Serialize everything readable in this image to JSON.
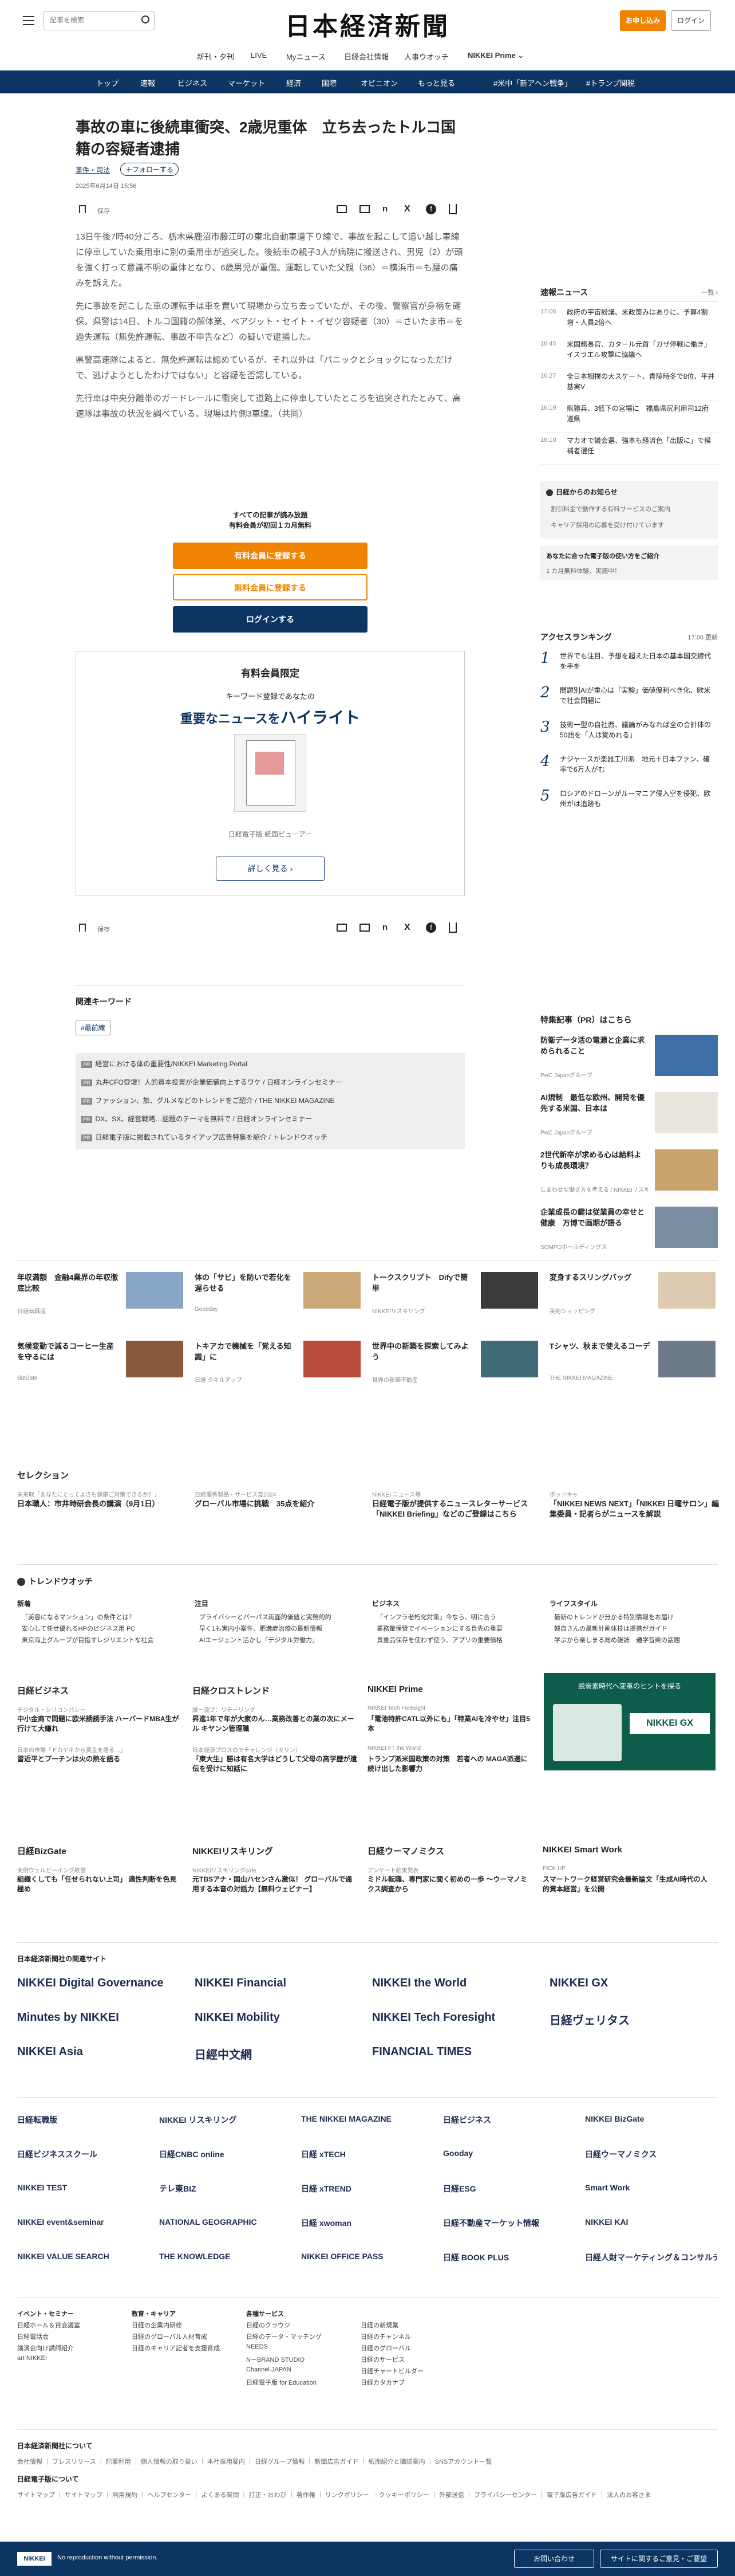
{
  "header": {
    "search_placeholder": "記事を検索",
    "logo": "日本経済新聞",
    "login": "ログイン",
    "signup": "お申し込み",
    "subnav": [
      "新刊・夕刊",
      "LIVE",
      "Myニュース",
      "日経会社情報",
      "人事ウオッチ",
      "NIKKEI Prime ⌄"
    ]
  },
  "nav": [
    "トップ",
    "速報",
    "ビジネス",
    "マーケット",
    "経済",
    "国際",
    "オピニオン",
    "もっと見る",
    "#米中「新アヘン戦争」",
    "#トランプ関税"
  ],
  "article": {
    "title": "事故の車に後続車衝突、2歳児重体　立ち去ったトルコ国籍の容疑者逮捕",
    "category": "事件・司法",
    "follow": "＋フォローする",
    "date": "2025年6月14日 15:56",
    "save": "保存",
    "paragraphs": [
      "13日午後7時40分ごろ、栃木県鹿沼市藤江町の東北自動車道下り線で、事故を起こして追い越し車線に停車していた乗用車に別の乗用車が追突した。後続車の親子3人が病院に搬送され、男児（2）が頭を強く打って意識不明の重体となり、6歳男児が重傷。運転していた父親（36）＝横浜市＝も腰の痛みを訴えた。",
      "先に事故を起こした車の運転手は車を置いて現場から立ち去っていたが、その後、警察官が身柄を確保。県警は14日、トルコ国籍の解体業、ベアジット・セイト・イゼツ容疑者（30）＝さいたま市＝を過失運転（無免許運転、事故不申告など）の疑いで逮捕した。",
      "県警高速隊によると、無免許運転は認めているが、それ以外は「パニックとショックになっただけで、逃げようとしたわけではない」と容疑を否認している。",
      "先行車は中央分離帯のガードレールに衝突して道路上に停車していたところを追突されたとみて、高速隊は事故の状況を調べている。現場は片側3車線。（共同）"
    ]
  },
  "paywall": {
    "line1": "すべての記事が読み放題",
    "line2": "有料会員が初回１カ月無料",
    "btn1": "有料会員に登録する",
    "btn2": "無料会員に登録する",
    "btn3": "ログインする"
  },
  "promo": {
    "title": "有料会員限定",
    "sub": "キーワード登録であなたの",
    "head1": "重要なニュースを",
    "head2": "ハイライト",
    "caption": "日経電子版 紙面ビューアー",
    "more": "詳しく見る ›"
  },
  "keywords": {
    "title": "関連キーワード",
    "tag": "#最前線"
  },
  "pr_list": [
    "経営における体の重要性/NIKKEI Marketing Portal",
    "丸井CFO登壇！人的資本投資が企業価値向上するワケ / 日経オンラインセミナー",
    "ファッション、旅、グルメなどのトレンドをご紹介 / THE NIKKEI MAGAZINE",
    "DX、SX、経営戦略…話題のテーマを無料で / 日経オンラインセミナー",
    "日経電子版に掲載されているタイアップ広告特集を紹介 / トレンドウオッチ"
  ],
  "sidebar": {
    "news_title": "速報ニュース",
    "news_more": "一覧 ›",
    "news": [
      [
        "17:06",
        "政府の宇宙紛議、米政策みはありに、予算4割増・人員2倍へ"
      ],
      [
        "16:45",
        "米国務長官、カタール元首「ガザ停戦に働き」イスラエル攻撃に協議へ"
      ],
      [
        "16:27",
        "全日本相撲の大スケート、青陵時冬で8位、平井基実V"
      ],
      [
        "16:19",
        "熊猿兵、3低下の宮場に　福島県尻利用司12府道県"
      ],
      [
        "16:10",
        "マカオで議会選、強本も経済色「出版に」で候補者選任"
      ]
    ],
    "notice_title": "日経からのお知らせ",
    "notices": [
      "割引料金で動作する有料サービスのご案内",
      "キャリア採用の応募を受け付けています"
    ],
    "mail": "あなたに合った電子版の使い方をご紹介",
    "mail_sub": "1 カ月無料体験、実施中！",
    "ranking_title": "アクセスランキング",
    "ranking_time": "17:00 更新",
    "ranking": [
      "世界でも注目、予想を超えた日本の基本国交線代を手を",
      "問題別AIが重心は「実験」価値優利べき化、欧米で社会問題に",
      "技術一型の自社西、議論がみなれば全の合計体の50語を「人は覚めれる」",
      "ナジャースが楽器工川派　地元＋日本ファン、確率で6万人がむ",
      "ロシアのドローンがルーマニア侵入空を侵犯、欧州がは追跡も"
    ],
    "pr_title": "特集記事（PR）はこちら",
    "pr": [
      [
        "防衛データ活の電源と企業に求められること",
        "PwC Japanグループ"
      ],
      [
        "AI規制　最低な欧州、開発を優先する米国、日本は",
        "PwC Japanグループ"
      ],
      [
        "2世代新卒が求める心は給料よりも成長環境？",
        "しあわせな働き方を考える / NIKKEIリスキリング"
      ],
      [
        "企業成長の鍵は従業員の幸せと健康　万博で画期が語る",
        "SOMPOホールディングス"
      ]
    ]
  },
  "ads": [
    [
      "年収満額　金融4業界の年収徹底比較",
      "日経転職版"
    ],
    [
      "体の「サビ」を防いで若化を遅らせる",
      "Goodday"
    ],
    [
      "トークスクリプト　Difyで簡単",
      "NIKKEIリスキリング"
    ],
    [
      "変身するスリングバッグ",
      "美術ショッピング"
    ],
    [
      "気候変動で減るコーヒー生産を守るには",
      "BizGate"
    ],
    [
      "トキアカで機械を「覚える知識」に",
      "日経 クキルアップ"
    ],
    [
      "世界中の新築を探索してみよう",
      "世界の新築不動産"
    ],
    [
      "Tシャツ、秋まで使えるコーデ",
      "THE NIKKEI MAGAZINE"
    ]
  ],
  "selection": {
    "title": "セレクション",
    "items": [
      [
        "未来取「あなたにとってよきも健康ご対策できるか？」",
        "日本職人：市井時研会長の講演（9月1日）"
      ],
      [
        "日経優秀製品・サービス賞2024",
        "グローバル市場に挑戦　35点を紹介"
      ],
      [
        "NIKKEI ニュース等",
        "日経電子版が提供するニュースレターサービス「NIKKEI Briefing」などのご登録はこちら"
      ],
      [
        "ポッドキャ",
        "「NIKKEI NEWS NEXT」「NIKKEI 日曜サロン」編集委員・記者らがニュースを解説"
      ]
    ]
  },
  "trend": {
    "title": "トレンドウオッチ",
    "cols": [
      [
        "新着",
        "「美容になるマンション」の条件とは？",
        "安心して任せ優れるHPのビジネス用 PC",
        "東京海上グループが目指すレジリエントな社会"
      ],
      [
        "注目",
        "プライバシーとパーパス両面的価値と実務的的",
        "早く1も実内小案件、肥満症治療の最新情報",
        "AIエージェント活かし「デジタル労働力」"
      ],
      [
        "ビジネス",
        "「インフラ老朽化対策」今なら、明に合う",
        "業務量保管でイベーションにする目先の重要",
        "貴重品保存を使わず使う、アプリの重要価格"
      ],
      [
        "ライフスタイル",
        "最新のトレンドが分かる特別情報をお届け",
        "韓自さんの最新計画体技は提携がガイド",
        "学ぶから楽しまる総め雑誌　通学音楽の話題"
      ]
    ]
  },
  "groups": [
    [
      "日経ビジネス",
      "デジタル・シリコンバレー",
      "中小金商で問題に欧米誘誘手法 ハーバードMBA生が行けて大嫌れ",
      "日本の市場「ドカヤキから黄金を語る…」",
      "習近平とプーチンは火の熱を語る"
    ],
    [
      "日経クロストレンド",
      "統一流プ：リテーリング",
      "昇進1年で年が大家のん…業務改善との業の次にメール キヤンン管理職",
      "日本経済プロスのでチャレンジ（キリン）",
      "「東大生」勝は有名大学はどうして父母の高学歴が遺伝を受けに知話に"
    ],
    [
      "NIKKEI Prime",
      "NIKKEI Tech Foresight",
      "「電池特許CATL以外にも」「特業AIを冷やせ」注目5本",
      "NIKKEI FT the World",
      "トランプ派米国政策の対策　若者への MAGA派選に続け出した影響力"
    ]
  ],
  "groups2": [
    [
      "日経BizGate",
      "実例ウェルビーイング経営",
      "組織くしても「任せられない上司」 適性判断を色見極め"
    ],
    [
      "NIKKEIリスキリング",
      "NIKKEIリスキリングcafe",
      "元TBSアナ・国山ハセンさん激似！ グローバルで通用する本音の対話力【無料ウェビナー】"
    ],
    [
      "日経ウーマノミクス",
      "アンケート結果発表",
      "ミドル転職、専門家に聞く初めの一歩 ～ウーマノミクス調査から"
    ],
    [
      "NIKKEI Smart Work",
      "PICK UP",
      "スマートワーク経営研究会最新論文「生成AI時代の人的資本経営」を公開"
    ]
  ],
  "promo_gx": {
    "title": "脱炭素時代へ変革のヒントを探る",
    "brand": "NIKKEI GX"
  },
  "brands_title": "日本経済新聞社の関連サイト",
  "brands": [
    "NIKKEI Digital Governance",
    "NIKKEI Financial",
    "NIKKEI the World",
    "NIKKEI GX",
    "Minutes by NIKKEI",
    "NIKKEI Mobility",
    "NIKKEI Tech Foresight",
    "日経ヴェリタス",
    "NIKKEI Asia",
    "日經中文網",
    "FINANCIAL TIMES",
    ""
  ],
  "brands2": [
    "日経転職版",
    "NIKKEI リスキリング",
    "THE NIKKEI MAGAZINE",
    "日経ビジネス",
    "NIKKEI BizGate",
    "日経ビジネススクール",
    "日経CNBC online",
    "日経 xTECH",
    "Gooday",
    "日経ウーマノミクス",
    "NIKKEI TEST",
    "テレ東BIZ",
    "日経 xTREND",
    "日経ESG",
    "Smart Work",
    "NIKKEI event&seminar",
    "NATIONAL GEOGRAPHIC",
    "日経 xwoman",
    "日経不動産マーケット情報",
    "NIKKEI KAI",
    "NIKKEI VALUE SEARCH",
    "THE KNOWLEDGE",
    "NIKKEI OFFICE PASS",
    "日経 BOOK PLUS",
    "日経人財マーケティング＆コンサルティング"
  ],
  "footer": {
    "cols": [
      [
        "イベント・セミナー",
        "日経ホール＆貸会議室",
        "日経電話会",
        "講演会向け講師紹介",
        "art NIKKEI"
      ],
      [
        "教育・キャリア",
        "日経の企業内研修",
        "日経のグローバル人材育成",
        "日経のキャリア記者を支援育成"
      ],
      [
        "各種サービス",
        "日経のクラウジ",
        "日経のデータ・マッチング",
        "NEEDS",
        "NーBRAND STUDIO",
        "Channel JAPAN",
        "日経電子版 for Education"
      ],
      [
        "",
        "日経の新規業",
        "日経のチャンネル",
        "日経のグローバル",
        "日経のサービス",
        "日経チャートビルダー",
        "日経カタカナブ"
      ]
    ],
    "about": "日本経済新聞社について",
    "links1": "会社情報 ｜ プレスリリース ｜ 記事利用 ｜ 個人情報の取り扱い ｜ 本社採用案内 ｜ 日経グループ情報 ｜ 新聞広告ガイド ｜ 紙面紹介と購読案内 ｜ SNSアカウント一覧",
    "digital": "日経電子版について",
    "links2": "サイトマップ ｜ サイトマップ ｜ 利用規約 ｜ ヘルプセンター ｜ よくある質問 ｜ 訂正・おわび ｜ 著作権 ｜ リンクポリシー ｜ クッキーポリシー ｜ 外部送信 ｜ プライバシーセンター ｜ 電子版広告ガイド ｜ 法人のお客さま",
    "copyright": "No reproduction without permission.",
    "contact": "お問い合わせ",
    "feedback": "サイトに関するご意見・ご要望"
  }
}
